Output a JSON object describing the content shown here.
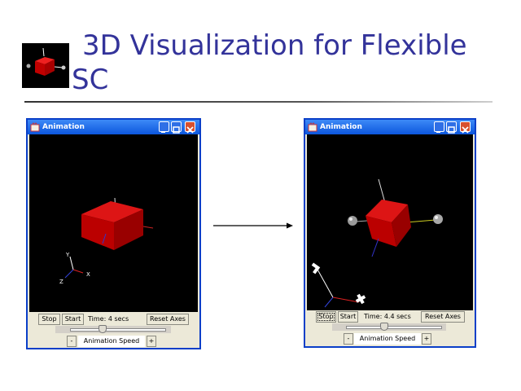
{
  "slide": {
    "title_line1": "3D Visualization for Flexible",
    "title_line2": "SC"
  },
  "windows": [
    {
      "title": "Animation",
      "stop_label": "Stop",
      "start_label": "Start",
      "time_text": "Time: 4 secs",
      "reset_label": "Reset Axes",
      "minus_label": "-",
      "plus_label": "+",
      "speed_label": "Animation Speed",
      "axis_x": "X",
      "axis_y": "Y",
      "axis_z": "Z"
    },
    {
      "title": "Animation",
      "stop_label": "Stop",
      "start_label": "Start",
      "time_text": "Time: 4.4 secs",
      "reset_label": "Reset Axes",
      "minus_label": "-",
      "plus_label": "+",
      "speed_label": "Animation Speed"
    }
  ],
  "colors": {
    "title": "#33339a",
    "cube": "#cc0000",
    "window_border": "#0a3fc8"
  },
  "icons": [
    "app-icon",
    "minimize-icon",
    "maximize-icon",
    "close-icon",
    "arrow-right-icon"
  ]
}
